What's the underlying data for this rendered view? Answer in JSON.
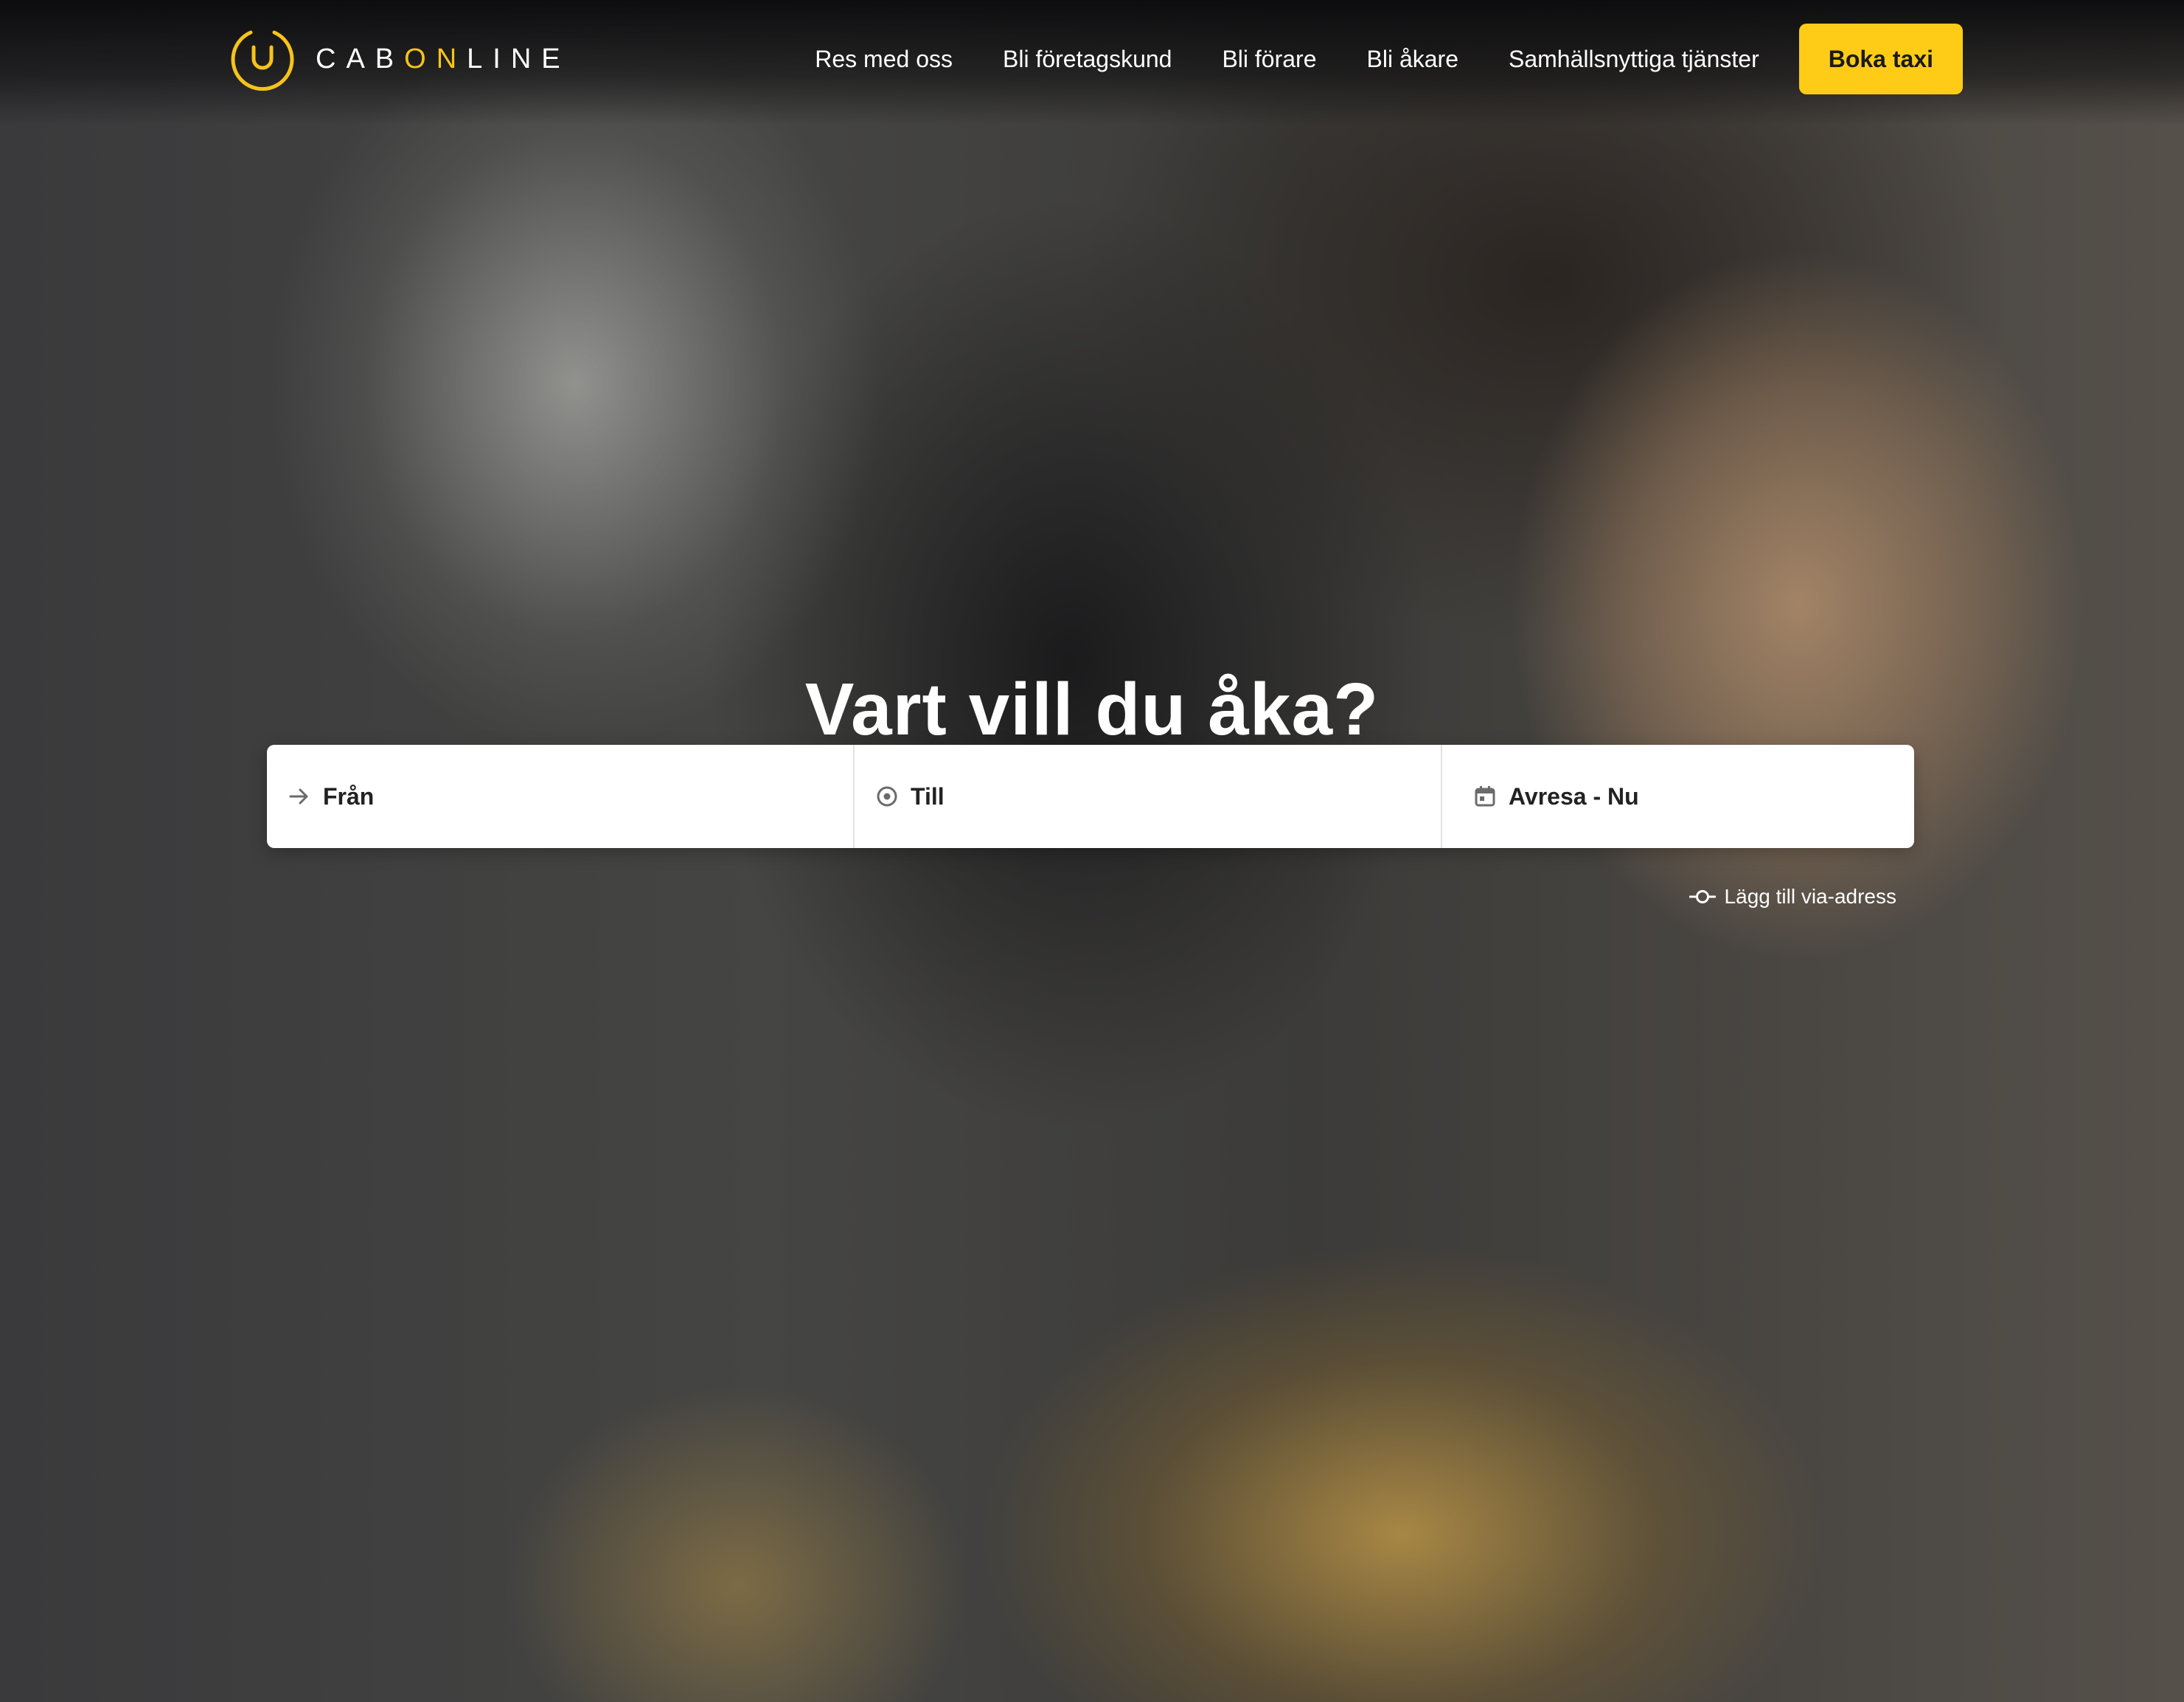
{
  "header": {
    "logo": {
      "prefix": "CAB",
      "accent": "ON",
      "suffix": "LINE",
      "brand_color": "#f7c31a"
    },
    "nav": [
      {
        "label": "Res med oss"
      },
      {
        "label": "Bli företagskund"
      },
      {
        "label": "Bli förare"
      },
      {
        "label": "Bli åkare"
      },
      {
        "label": "Samhällsnyttiga tjänster"
      }
    ],
    "cta": {
      "label": "Boka taxi",
      "color": "#fecc17"
    }
  },
  "hero": {
    "title": "Vart vill du åka?",
    "search": {
      "from": {
        "label": "Från",
        "icon": "arrow-right-icon"
      },
      "to": {
        "label": "Till",
        "icon": "destination-circle-icon"
      },
      "when": {
        "label": "Avresa - Nu",
        "icon": "calendar-icon"
      }
    },
    "via": {
      "label": "Lägg till via-adress",
      "icon": "via-point-icon"
    }
  }
}
